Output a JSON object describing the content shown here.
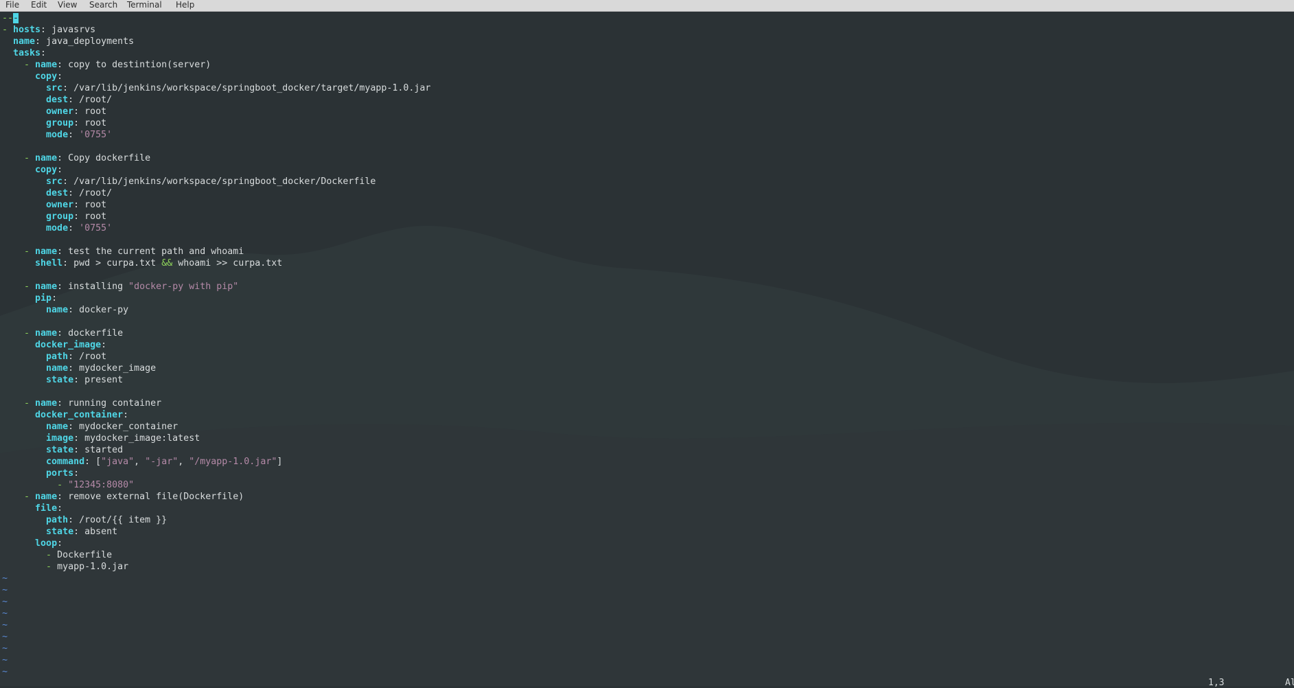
{
  "menu": [
    "File",
    "Edit",
    "View",
    "Search",
    "Terminal",
    "Help"
  ],
  "editor": {
    "lines": [
      [
        {
          "t": "--",
          "c": "dash"
        },
        {
          "t": "-",
          "c": "cursor"
        }
      ],
      [
        {
          "t": "- ",
          "c": "dash"
        },
        {
          "t": "hosts",
          "c": "k"
        },
        {
          "t": ": javasrvs"
        }
      ],
      [
        {
          "t": "  "
        },
        {
          "t": "name",
          "c": "k"
        },
        {
          "t": ": java_deployments"
        }
      ],
      [
        {
          "t": "  "
        },
        {
          "t": "tasks",
          "c": "k"
        },
        {
          "t": ":"
        }
      ],
      [
        {
          "t": "    "
        },
        {
          "t": "- ",
          "c": "dash"
        },
        {
          "t": "name",
          "c": "k"
        },
        {
          "t": ": copy to destintion(server)"
        }
      ],
      [
        {
          "t": "      "
        },
        {
          "t": "copy",
          "c": "k"
        },
        {
          "t": ":"
        }
      ],
      [
        {
          "t": "        "
        },
        {
          "t": "src",
          "c": "k"
        },
        {
          "t": ": /var/lib/jenkins/workspace/springboot_docker/target/myapp-1.0.jar"
        }
      ],
      [
        {
          "t": "        "
        },
        {
          "t": "dest",
          "c": "k"
        },
        {
          "t": ": /root/"
        }
      ],
      [
        {
          "t": "        "
        },
        {
          "t": "owner",
          "c": "k"
        },
        {
          "t": ": root"
        }
      ],
      [
        {
          "t": "        "
        },
        {
          "t": "group",
          "c": "k"
        },
        {
          "t": ": root"
        }
      ],
      [
        {
          "t": "        "
        },
        {
          "t": "mode",
          "c": "k"
        },
        {
          "t": ": "
        },
        {
          "t": "'0755'",
          "c": "str"
        }
      ],
      [
        {
          "t": ""
        }
      ],
      [
        {
          "t": "    "
        },
        {
          "t": "- ",
          "c": "dash"
        },
        {
          "t": "name",
          "c": "k"
        },
        {
          "t": ": Copy dockerfile"
        }
      ],
      [
        {
          "t": "      "
        },
        {
          "t": "copy",
          "c": "k"
        },
        {
          "t": ":"
        }
      ],
      [
        {
          "t": "        "
        },
        {
          "t": "src",
          "c": "k"
        },
        {
          "t": ": /var/lib/jenkins/workspace/springboot_docker/Dockerfile"
        }
      ],
      [
        {
          "t": "        "
        },
        {
          "t": "dest",
          "c": "k"
        },
        {
          "t": ": /root/"
        }
      ],
      [
        {
          "t": "        "
        },
        {
          "t": "owner",
          "c": "k"
        },
        {
          "t": ": root"
        }
      ],
      [
        {
          "t": "        "
        },
        {
          "t": "group",
          "c": "k"
        },
        {
          "t": ": root"
        }
      ],
      [
        {
          "t": "        "
        },
        {
          "t": "mode",
          "c": "k"
        },
        {
          "t": ": "
        },
        {
          "t": "'0755'",
          "c": "str"
        }
      ],
      [
        {
          "t": ""
        }
      ],
      [
        {
          "t": "    "
        },
        {
          "t": "- ",
          "c": "dash"
        },
        {
          "t": "name",
          "c": "k"
        },
        {
          "t": ": test the current path and whoami"
        }
      ],
      [
        {
          "t": "      "
        },
        {
          "t": "shell",
          "c": "k"
        },
        {
          "t": ": pwd > curpa.txt "
        },
        {
          "t": "&&",
          "c": "amp"
        },
        {
          "t": " whoami >> curpa.txt"
        }
      ],
      [
        {
          "t": ""
        }
      ],
      [
        {
          "t": "    "
        },
        {
          "t": "- ",
          "c": "dash"
        },
        {
          "t": "name",
          "c": "k"
        },
        {
          "t": ": installing "
        },
        {
          "t": "\"docker-py with pip\"",
          "c": "str"
        }
      ],
      [
        {
          "t": "      "
        },
        {
          "t": "pip",
          "c": "k"
        },
        {
          "t": ":"
        }
      ],
      [
        {
          "t": "        "
        },
        {
          "t": "name",
          "c": "k"
        },
        {
          "t": ": docker-py"
        }
      ],
      [
        {
          "t": ""
        }
      ],
      [
        {
          "t": "    "
        },
        {
          "t": "- ",
          "c": "dash"
        },
        {
          "t": "name",
          "c": "k"
        },
        {
          "t": ": dockerfile"
        }
      ],
      [
        {
          "t": "      "
        },
        {
          "t": "docker_image",
          "c": "k"
        },
        {
          "t": ":"
        }
      ],
      [
        {
          "t": "        "
        },
        {
          "t": "path",
          "c": "k"
        },
        {
          "t": ": /root"
        }
      ],
      [
        {
          "t": "        "
        },
        {
          "t": "name",
          "c": "k"
        },
        {
          "t": ": mydocker_image"
        }
      ],
      [
        {
          "t": "        "
        },
        {
          "t": "state",
          "c": "k"
        },
        {
          "t": ": present"
        }
      ],
      [
        {
          "t": ""
        }
      ],
      [
        {
          "t": "    "
        },
        {
          "t": "- ",
          "c": "dash"
        },
        {
          "t": "name",
          "c": "k"
        },
        {
          "t": ": running container"
        }
      ],
      [
        {
          "t": "      "
        },
        {
          "t": "docker_container",
          "c": "k"
        },
        {
          "t": ":"
        }
      ],
      [
        {
          "t": "        "
        },
        {
          "t": "name",
          "c": "k"
        },
        {
          "t": ": mydocker_container"
        }
      ],
      [
        {
          "t": "        "
        },
        {
          "t": "image",
          "c": "k"
        },
        {
          "t": ": mydocker_image:latest"
        }
      ],
      [
        {
          "t": "        "
        },
        {
          "t": "state",
          "c": "k"
        },
        {
          "t": ": started"
        }
      ],
      [
        {
          "t": "        "
        },
        {
          "t": "command",
          "c": "k"
        },
        {
          "t": ": ["
        },
        {
          "t": "\"java\"",
          "c": "str"
        },
        {
          "t": ", "
        },
        {
          "t": "\"-jar\"",
          "c": "str"
        },
        {
          "t": ", "
        },
        {
          "t": "\"/myapp-1.0.jar\"",
          "c": "str"
        },
        {
          "t": "]"
        }
      ],
      [
        {
          "t": "        "
        },
        {
          "t": "ports",
          "c": "k"
        },
        {
          "t": ":"
        }
      ],
      [
        {
          "t": "          "
        },
        {
          "t": "- ",
          "c": "dash"
        },
        {
          "t": "\"12345:8080\"",
          "c": "str"
        }
      ],
      [
        {
          "t": "    "
        },
        {
          "t": "- ",
          "c": "dash"
        },
        {
          "t": "name",
          "c": "k"
        },
        {
          "t": ": remove external file(Dockerfile)"
        }
      ],
      [
        {
          "t": "      "
        },
        {
          "t": "file",
          "c": "k"
        },
        {
          "t": ":"
        }
      ],
      [
        {
          "t": "        "
        },
        {
          "t": "path",
          "c": "k"
        },
        {
          "t": ": /root/{{ item }}"
        }
      ],
      [
        {
          "t": "        "
        },
        {
          "t": "state",
          "c": "k"
        },
        {
          "t": ": absent"
        }
      ],
      [
        {
          "t": "      "
        },
        {
          "t": "loop",
          "c": "k"
        },
        {
          "t": ":"
        }
      ],
      [
        {
          "t": "        "
        },
        {
          "t": "- ",
          "c": "dash"
        },
        {
          "t": "Dockerfile"
        }
      ],
      [
        {
          "t": "        "
        },
        {
          "t": "- ",
          "c": "dash"
        },
        {
          "t": "myapp-1.0.jar"
        }
      ],
      [
        {
          "t": "~",
          "c": "tilde"
        }
      ],
      [
        {
          "t": "~",
          "c": "tilde"
        }
      ],
      [
        {
          "t": "~",
          "c": "tilde"
        }
      ],
      [
        {
          "t": "~",
          "c": "tilde"
        }
      ],
      [
        {
          "t": "~",
          "c": "tilde"
        }
      ],
      [
        {
          "t": "~",
          "c": "tilde"
        }
      ],
      [
        {
          "t": "~",
          "c": "tilde"
        }
      ],
      [
        {
          "t": "~",
          "c": "tilde"
        }
      ],
      [
        {
          "t": "~",
          "c": "tilde"
        }
      ]
    ]
  },
  "status": {
    "position": "1,3",
    "scroll": "Al"
  }
}
